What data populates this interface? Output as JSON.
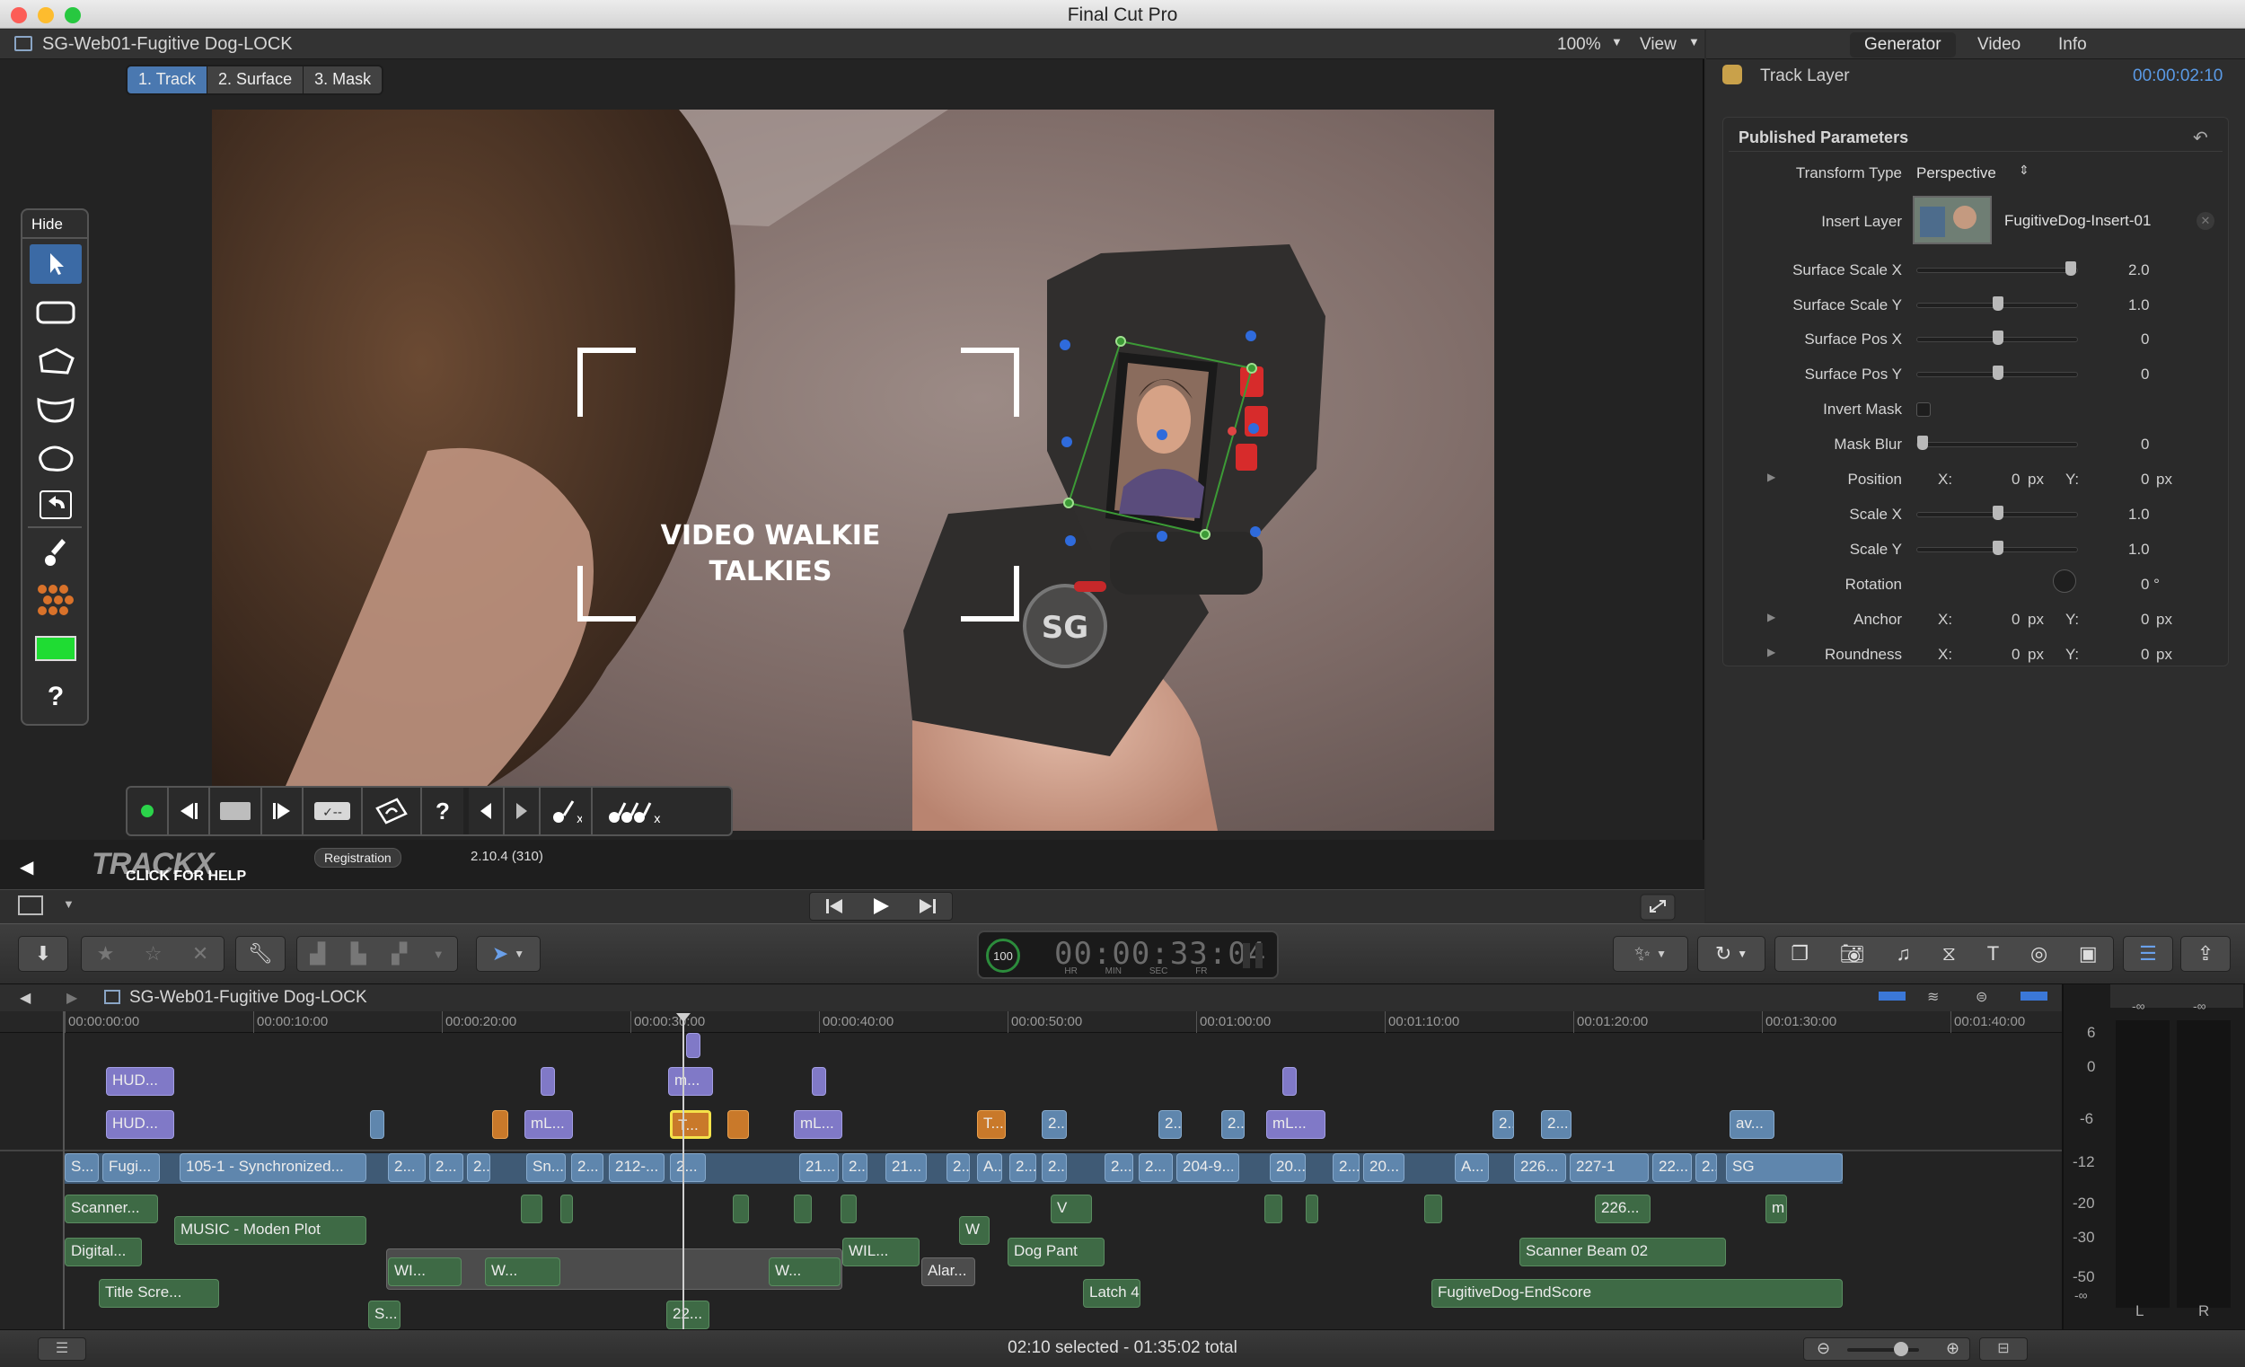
{
  "app": {
    "title": "Final Cut Pro"
  },
  "viewer": {
    "project_title": "SG-Web01-Fugitive Dog-LOCK",
    "zoom": "100%",
    "view_menu": "View",
    "tabs": [
      {
        "label": "1. Track",
        "active": true
      },
      {
        "label": "2. Surface"
      },
      {
        "label": "3. Mask"
      }
    ],
    "overlay_text_line1": "VIDEO WALKIE",
    "overlay_text_line2": "TALKIES",
    "sidebar_hide_label": "Hide",
    "help_glyph": "?",
    "trackx_logo": "TRACKX",
    "click_for_help": "CLICK FOR HELP",
    "registration_button": "Registration",
    "version": "2.10.4 (310)",
    "swatch_color": "#1fdc33"
  },
  "inspector": {
    "tabs": [
      "Generator",
      "Video",
      "Info"
    ],
    "item_title": "Track Layer",
    "item_duration": "00:00:02:10",
    "section_title": "Published Parameters",
    "params": {
      "transform_type": {
        "label": "Transform Type",
        "value": "Perspective"
      },
      "insert_layer": {
        "label": "Insert Layer",
        "value": "FugitiveDog-Insert-01"
      },
      "surface_scale_x": {
        "label": "Surface Scale X",
        "value": "2.0",
        "level": 0.95
      },
      "surface_scale_y": {
        "label": "Surface Scale Y",
        "value": "1.0",
        "level": 0.5
      },
      "surface_pos_x": {
        "label": "Surface Pos X",
        "value": "0",
        "level": 0.5
      },
      "surface_pos_y": {
        "label": "Surface Pos Y",
        "value": "0",
        "level": 0.5
      },
      "invert_mask": {
        "label": "Invert Mask"
      },
      "mask_blur": {
        "label": "Mask Blur",
        "value": "0",
        "level": 0.0
      },
      "position": {
        "label": "Position",
        "x_label": "X:",
        "x": "0",
        "x_unit": "px",
        "y_label": "Y:",
        "y": "0",
        "y_unit": "px"
      },
      "scale_x": {
        "label": "Scale X",
        "value": "1.0",
        "level": 0.5
      },
      "scale_y": {
        "label": "Scale Y",
        "value": "1.0",
        "level": 0.5
      },
      "rotation": {
        "label": "Rotation",
        "value": "0 °"
      },
      "anchor": {
        "label": "Anchor",
        "x_label": "X:",
        "x": "0",
        "x_unit": "px",
        "y_label": "Y:",
        "y": "0",
        "y_unit": "px"
      },
      "roundness": {
        "label": "Roundness",
        "x_label": "X:",
        "x": "0",
        "x_unit": "px",
        "y_label": "Y:",
        "y": "0",
        "y_unit": "px"
      }
    }
  },
  "timecode": {
    "percent": "100",
    "value": "00:00:33:04",
    "units": [
      "HR",
      "MIN",
      "SEC",
      "FR"
    ]
  },
  "timeline": {
    "project_title": "SG-Web01-Fugitive Dog-LOCK",
    "ruler": [
      "00:00:00:00",
      "00:00:10:00",
      "00:00:20:00",
      "00:00:30:00",
      "00:00:40:00",
      "00:00:50:00",
      "00:01:00:00",
      "00:01:10:00",
      "00:01:20:00",
      "00:01:30:00",
      "00:01:40:00"
    ],
    "clips": {
      "hud1": "HUD...",
      "hud2": "HUD...",
      "m1": "m...",
      "ml1": "mL...",
      "t1": "T...",
      "ml2": "mL...",
      "t2": "T...",
      "n2a": "2...",
      "n2b": "2...",
      "n2c": "2...",
      "ml3": "mL...",
      "n2d": "2...",
      "n2e": "2...",
      "av": "av...",
      "s1": "S...",
      "fugi": "Fugi...",
      "synced": "105-1 - Synchronized...",
      "p2a": "2...",
      "p2b": "2...",
      "p2c": "2...",
      "sn": "Sn...",
      "p2d": "2...",
      "p212": "212-...",
      "p2e": "2...",
      "p21a": "21...",
      "p2f": "2...",
      "p21b": "21...",
      "p2g": "2...",
      "pA": "A...",
      "p2h": "2...",
      "p2i": "2...",
      "p2j": "2...",
      "p2k": "2...",
      "p204": "204-9...",
      "p20a": "20...",
      "p2l": "2...",
      "p20b": "20...",
      "pA2": "A...",
      "p226": "226...",
      "p227": "227-1",
      "p22": "22...",
      "p2m": "2...",
      "sg": "SG",
      "scanner": "Scanner...",
      "music": "MUSIC - Moden Plot",
      "digital": "Digital...",
      "title_scr": "Title Scre...",
      "wi1": "WI...",
      "w1": "W...",
      "w2": "W...",
      "wil": "WIL...",
      "alar": "Alar...",
      "w3": "W",
      "dogpant": "Dog Pant",
      "v": "V",
      "latch": "Latch 4",
      "s2": "S...",
      "p22b": "22...",
      "c226": "226...",
      "m": "m",
      "scanner_beam": "Scanner Beam 02",
      "endscore": "FugitiveDog-EndScore"
    }
  },
  "meters": {
    "scale": [
      "6",
      "0",
      "-6",
      "-12",
      "-20",
      "-30",
      "-50",
      "-∞"
    ],
    "peak_left": "-∞",
    "peak_right": "-∞",
    "left": "L",
    "right": "R"
  },
  "status": {
    "text": "02:10 selected - 01:35:02 total"
  }
}
